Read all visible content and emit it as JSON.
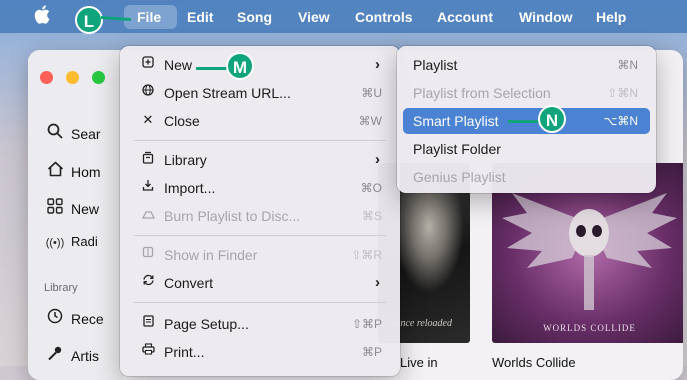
{
  "menubar": {
    "items": [
      {
        "label": "File"
      },
      {
        "label": "Edit"
      },
      {
        "label": "Song"
      },
      {
        "label": "View"
      },
      {
        "label": "Controls"
      },
      {
        "label": "Account"
      },
      {
        "label": "Window"
      },
      {
        "label": "Help"
      }
    ]
  },
  "sidebar": {
    "items": [
      {
        "label": "Sear",
        "icon": "search-icon"
      },
      {
        "label": "Hom",
        "icon": "home-icon"
      },
      {
        "label": "New",
        "icon": "grid-icon"
      },
      {
        "label": "Radi",
        "icon": "radio-icon"
      }
    ],
    "section_label": "Library",
    "library_items": [
      {
        "label": "Rece",
        "icon": "clock-icon"
      },
      {
        "label": "Artis",
        "icon": "microphone-icon"
      }
    ]
  },
  "content": {
    "album1_caption": "Live in",
    "album2_caption": "Worlds Collide",
    "album2_cover_text": "WORLDS COLLIDE",
    "album1_cover_text": "cagnce reloaded"
  },
  "file_menu": {
    "items": [
      {
        "label": "New",
        "shortcut": "",
        "icon": "new-window-icon",
        "submenu": true
      },
      {
        "label": "Open Stream URL...",
        "shortcut": "⌘U",
        "icon": "globe-icon"
      },
      {
        "label": "Close",
        "shortcut": "⌘W",
        "icon": "close-icon"
      },
      {
        "label": "Library",
        "shortcut": "",
        "icon": "library-icon",
        "submenu": true
      },
      {
        "label": "Import...",
        "shortcut": "⌘O",
        "icon": "import-icon"
      },
      {
        "label": "Burn Playlist to Disc...",
        "shortcut": "⌘S",
        "icon": "disc-icon",
        "disabled": true
      },
      {
        "label": "Show in Finder",
        "shortcut": "⇧⌘R",
        "icon": "finder-icon",
        "disabled": true
      },
      {
        "label": "Convert",
        "shortcut": "",
        "icon": "convert-icon",
        "submenu": true
      },
      {
        "label": "Page Setup...",
        "shortcut": "⇧⌘P",
        "icon": "page-icon"
      },
      {
        "label": "Print...",
        "shortcut": "⌘P",
        "icon": "print-icon"
      }
    ],
    "arrow": "›"
  },
  "new_submenu": {
    "items": [
      {
        "label": "Playlist",
        "shortcut": "⌘N"
      },
      {
        "label": "Playlist from Selection",
        "shortcut": "⇧⌘N",
        "disabled": true
      },
      {
        "label": "Smart Playlist",
        "shortcut": "⌥⌘N",
        "selected": true
      },
      {
        "label": "Playlist Folder",
        "shortcut": ""
      },
      {
        "label": "Genius Playlist",
        "shortcut": "",
        "disabled": true
      }
    ]
  },
  "callouts": {
    "L": "L",
    "M": "M",
    "N": "N"
  },
  "colors": {
    "callout": "#0fa47c",
    "selection": "#4b82d3",
    "menubar": "#4e80be"
  }
}
